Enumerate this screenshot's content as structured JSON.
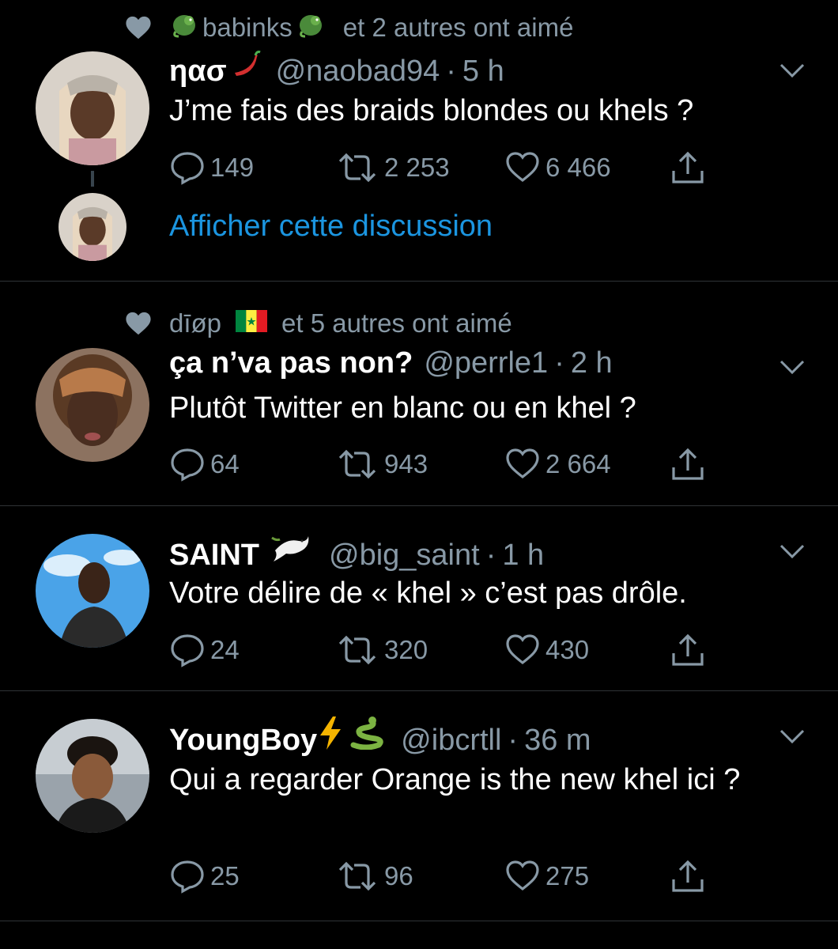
{
  "colors": {
    "background": "#000000",
    "text": "#ffffff",
    "secondary": "#8899a6",
    "link": "#1b95e0",
    "divider": "#2f3336"
  },
  "tweets": [
    {
      "social_context": {
        "icon": "heart-icon",
        "liker": "babinks",
        "liker_emoji": "dragon-emoji",
        "text": "et 2 autres ont aimé"
      },
      "name": "ηασ",
      "name_emoji": "hot-pepper-emoji",
      "handle": "@naobad94",
      "time": "5 h",
      "text": "J’me fais des braids blondes ou khels ?",
      "replies": "149",
      "retweets": "2 253",
      "likes": "6 466",
      "show_thread": "Afficher cette discussion"
    },
    {
      "social_context": {
        "icon": "heart-icon",
        "liker": "dīøp",
        "liker_emoji": "senegal-flag-emoji",
        "text": "et 5 autres ont aimé"
      },
      "name": "ça n’va pas non?",
      "handle": "@perrle1",
      "time": "2 h",
      "text": "Plutôt Twitter en blanc ou en khel ?",
      "replies": "64",
      "retweets": "943",
      "likes": "2 664"
    },
    {
      "name": "SAINT",
      "name_emoji": "dove-emoji",
      "handle": "@big_saint",
      "time": "1 h",
      "text": "Votre délire de « khel » c’est pas drôle.",
      "replies": "24",
      "retweets": "320",
      "likes": "430"
    },
    {
      "name": "YoungBoy",
      "name_emoji": "lightning-snake-emoji",
      "handle": "@ibcrtll",
      "time": "36 m",
      "text": "Qui a regarder Orange is the new khel ici ?",
      "replies": "25",
      "retweets": "96",
      "likes": "275"
    }
  ],
  "separator": "·"
}
